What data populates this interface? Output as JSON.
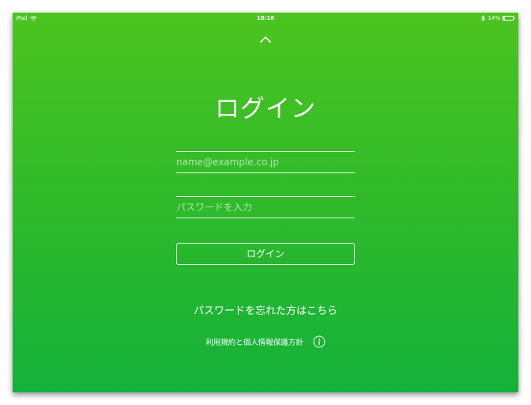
{
  "status_bar": {
    "device": "iPad",
    "time": "18:16",
    "battery_text": "14%",
    "battery_level": 0.14,
    "icons": [
      "wifi-icon",
      "bluetooth-icon",
      "battery-icon"
    ]
  },
  "header": {
    "collapse_icon": "chevron-up-icon"
  },
  "login": {
    "title": "ログイン",
    "email_placeholder": "name@example.co.jp",
    "email_value": "",
    "password_placeholder": "パスワードを入力",
    "password_value": "",
    "submit_label": "ログイン"
  },
  "links": {
    "forgot_password": "パスワードを忘れた方はこちら",
    "terms": "利用規約と個人情報保護方針",
    "info_icon": "info-icon"
  },
  "colors": {
    "background_top": "#4cc41f",
    "background_bottom": "#14b13a",
    "foreground": "#ffffff"
  }
}
